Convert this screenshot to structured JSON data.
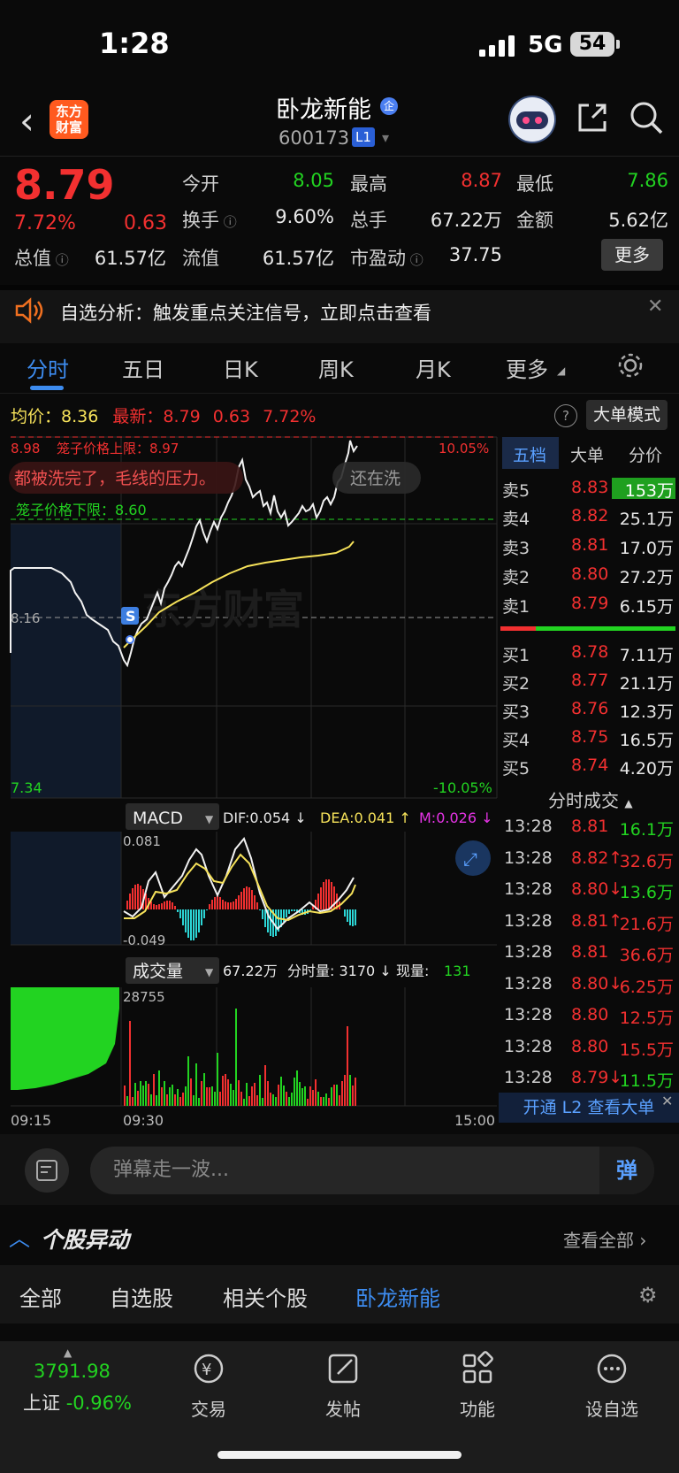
{
  "status_bar": {
    "time": "1:28",
    "network": "5G",
    "battery": "54"
  },
  "header": {
    "logo_text": "东方财富",
    "stock_name": "卧龙新能",
    "badge": "企",
    "stock_code": "600173",
    "level": "L1"
  },
  "quote": {
    "price": "8.79",
    "change_pct": "7.72%",
    "change": "0.63",
    "fields": [
      {
        "label": "今开",
        "value": "8.05",
        "color": "#22d321"
      },
      {
        "label": "最高",
        "value": "8.87",
        "color": "#f23030"
      },
      {
        "label": "最低",
        "value": "7.86",
        "color": "#22d321"
      },
      {
        "label": "换手",
        "value": "9.60%",
        "color": "#e8e8e8"
      },
      {
        "label": "总手",
        "value": "67.22万",
        "color": "#e8e8e8"
      },
      {
        "label": "金额",
        "value": "5.62亿",
        "color": "#e8e8e8"
      },
      {
        "label": "总值",
        "value": "61.57亿",
        "color": "#e8e8e8"
      },
      {
        "label": "流值",
        "value": "61.57亿",
        "color": "#e8e8e8"
      },
      {
        "label": "市盈动",
        "value": "37.75",
        "color": "#e8e8e8"
      }
    ],
    "more_label": "更多"
  },
  "notice": {
    "text": "自选分析：触发重点关注信号，立即点击查看"
  },
  "tabs": [
    "分时",
    "五日",
    "日K",
    "周K",
    "月K",
    "更多"
  ],
  "active_tab": "分时",
  "avg_row": {
    "avg_label": "均价：",
    "avg_value": "8.36",
    "latest_label": "最新：",
    "latest_value": "8.79",
    "latest_chg": "0.63",
    "latest_pct": "7.72%",
    "mode_button": "大单模式"
  },
  "chart": {
    "upper_limit_price": "8.98",
    "cage_upper": "笼子价格上限：8.97",
    "cage_lower": "笼子价格下限：8.60",
    "upper_pct": "10.05%",
    "lower_price": "7.34",
    "lower_pct": "-10.05%",
    "prev_close": "8.16",
    "danmu_1": "都被洗完了，毛线的压力。",
    "danmu_2": "还在洗",
    "signal_marker": "S",
    "watermark": "东方财富"
  },
  "chart_data": [
    {
      "type": "line",
      "title": "分时",
      "series": [
        {
          "name": "均价",
          "values": [
            8.3,
            8.31,
            8.33,
            8.34,
            8.35,
            8.37,
            8.39,
            8.41,
            8.43,
            8.44
          ]
        }
      ],
      "ylim": [
        7.34,
        8.98
      ],
      "x_ticks": [
        "09:15",
        "09:30",
        "15:00"
      ]
    },
    {
      "type": "bar",
      "title": "MACD",
      "indicators": {
        "DIF": "0.054",
        "DEA": "0.041",
        "M": "0.026"
      },
      "ylim": [
        -0.049,
        0.081
      ]
    },
    {
      "type": "bar",
      "title": "成交量",
      "indicators": {
        "total": "67.22万",
        "minute": "3170",
        "now": "131"
      },
      "ymax": 28755
    }
  ],
  "macd": {
    "label": "MACD",
    "dif": "DIF:0.054 ↓",
    "dea": "DEA:0.041 ↑",
    "m": "M:0.026 ↓",
    "top": "0.081",
    "bottom": "-0.049"
  },
  "volume": {
    "label": "成交量",
    "total": "67.22万",
    "minute_label": "分时量: 3170 ↓",
    "now_label": "现量:",
    "now_value": "131",
    "max": "28755"
  },
  "time_axis": [
    "09:15",
    "09:30",
    "15:00"
  ],
  "order_book": {
    "tabs": [
      "五档",
      "大单",
      "分价"
    ],
    "asks": [
      {
        "label": "卖5",
        "price": "8.83",
        "vol": "153万",
        "color": "#22d321"
      },
      {
        "label": "卖4",
        "price": "8.82",
        "vol": "25.1万",
        "color": "#e8e8e8"
      },
      {
        "label": "卖3",
        "price": "8.81",
        "vol": "17.0万",
        "color": "#e8e8e8"
      },
      {
        "label": "卖2",
        "price": "8.80",
        "vol": "27.2万",
        "color": "#e8e8e8"
      },
      {
        "label": "卖1",
        "price": "8.79",
        "vol": "6.15万",
        "color": "#e8e8e8"
      }
    ],
    "bids": [
      {
        "label": "买1",
        "price": "8.78",
        "vol": "7.11万"
      },
      {
        "label": "买2",
        "price": "8.77",
        "vol": "21.1万"
      },
      {
        "label": "买3",
        "price": "8.76",
        "vol": "12.3万"
      },
      {
        "label": "买4",
        "price": "8.75",
        "vol": "16.5万"
      },
      {
        "label": "买5",
        "price": "8.74",
        "vol": "4.20万"
      }
    ]
  },
  "trades": {
    "title": "分时成交",
    "rows": [
      {
        "time": "13:28",
        "price": "8.81",
        "arrow": "",
        "vol": "16.1万",
        "color": "#22d321"
      },
      {
        "time": "13:28",
        "price": "8.82",
        "arrow": "↑",
        "vol": "32.6万",
        "color": "#f23030"
      },
      {
        "time": "13:28",
        "price": "8.80",
        "arrow": "↓",
        "vol": "13.6万",
        "color": "#22d321"
      },
      {
        "time": "13:28",
        "price": "8.81",
        "arrow": "↑",
        "vol": "21.6万",
        "color": "#f23030"
      },
      {
        "time": "13:28",
        "price": "8.81",
        "arrow": "",
        "vol": "36.6万",
        "color": "#f23030"
      },
      {
        "time": "13:28",
        "price": "8.80",
        "arrow": "↓",
        "vol": "6.25万",
        "color": "#f23030"
      },
      {
        "time": "13:28",
        "price": "8.80",
        "arrow": "",
        "vol": "12.5万",
        "color": "#f23030"
      },
      {
        "time": "13:28",
        "price": "8.80",
        "arrow": "",
        "vol": "15.5万",
        "color": "#f23030"
      },
      {
        "time": "13:28",
        "price": "8.79",
        "arrow": "↓",
        "vol": "11.5万",
        "color": "#22d321"
      }
    ],
    "l2_banner": "开通 L2 查看大单"
  },
  "danmu_input": {
    "placeholder": "弹幕走一波...",
    "button": "弹"
  },
  "section": {
    "title": "个股异动",
    "see_all": "查看全部",
    "filters": [
      "全部",
      "自选股",
      "相关个股",
      "卧龙新能"
    ],
    "active_filter": "卧龙新能"
  },
  "bottom_nav": {
    "index_value": "3791.98",
    "index_name": "上证",
    "index_pct": "-0.96%",
    "items": [
      "交易",
      "发帖",
      "功能",
      "设自选"
    ]
  }
}
